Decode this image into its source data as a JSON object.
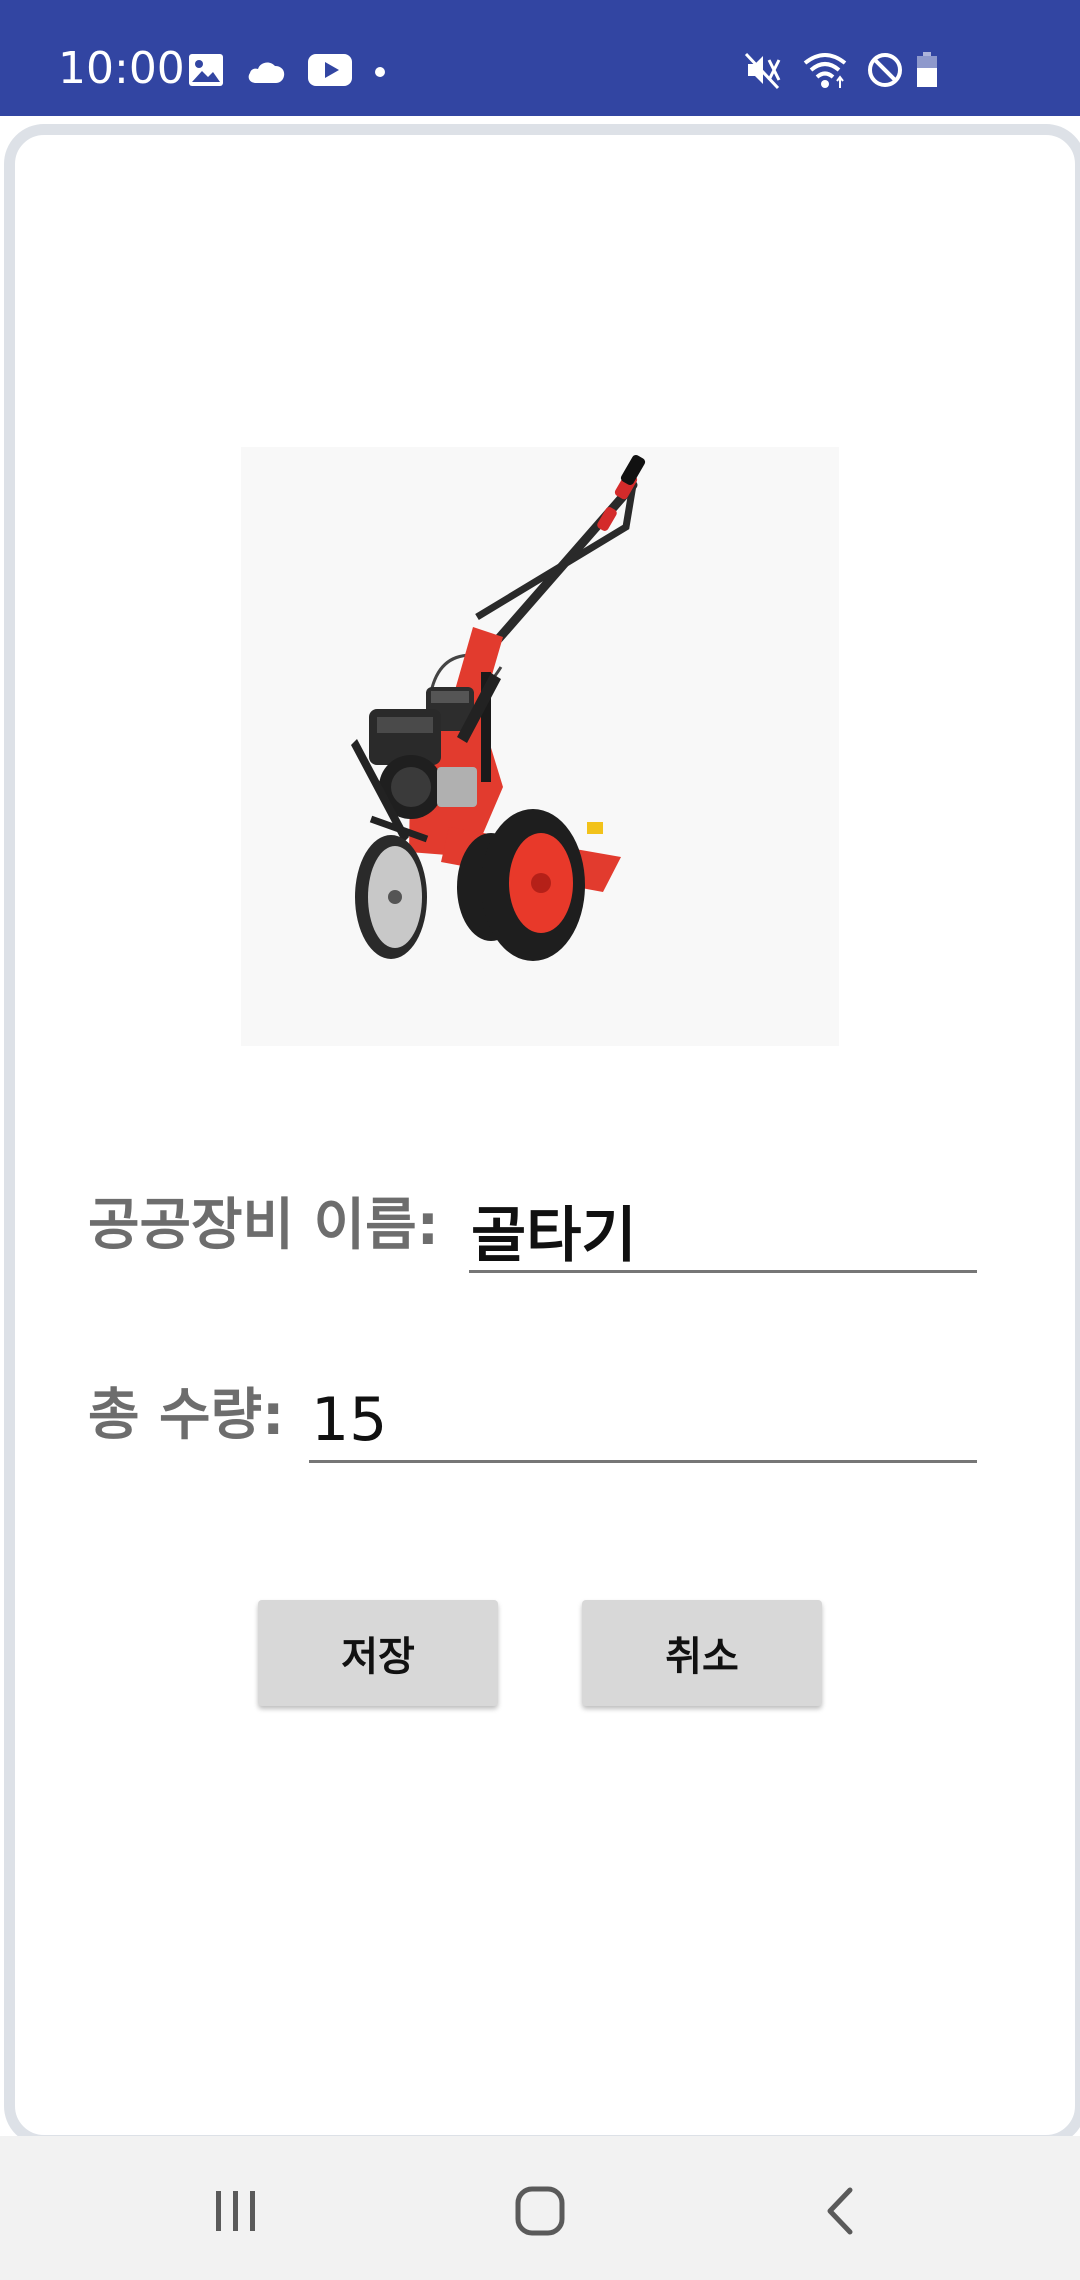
{
  "status_bar": {
    "time": "10:00",
    "left_icons": [
      "image-icon",
      "cloud-icon",
      "youtube-icon",
      "dot-icon"
    ],
    "right_icons": [
      "mute-icon",
      "wifi-icon",
      "block-icon",
      "battery-icon"
    ],
    "color": "#3245a2"
  },
  "equipment": {
    "image_name": "rotary-tiller-image"
  },
  "form": {
    "name_label": "공공장비 이름:",
    "name_value": "골타기",
    "qty_label": "총 수량:",
    "qty_value": "15"
  },
  "buttons": {
    "save_label": "저장",
    "cancel_label": "취소"
  },
  "nav_bar": {
    "buttons": [
      "recent-apps-icon",
      "home-icon",
      "back-icon"
    ]
  }
}
